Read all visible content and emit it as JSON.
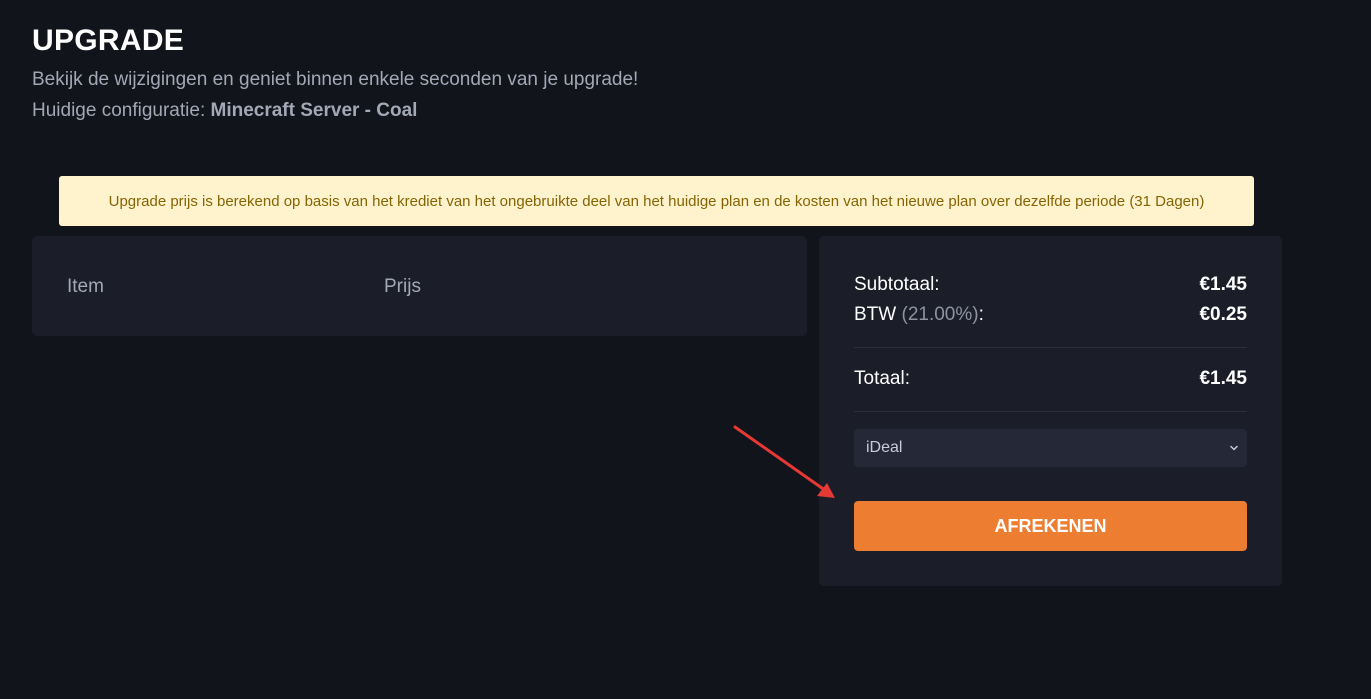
{
  "header": {
    "title": "UPGRADE",
    "subtitle": "Bekijk de wijzigingen en geniet binnen enkele seconden van je upgrade!",
    "config_label": "Huidige configuratie: ",
    "config_value": "Minecraft Server - Coal"
  },
  "notice": {
    "text": "Upgrade prijs is berekend op basis van het krediet van het ongebruikte deel van het huidige plan en de kosten van het nieuwe plan over dezelfde periode (31 Dagen)"
  },
  "items_table": {
    "columns": [
      "Item",
      "Prijs"
    ]
  },
  "summary": {
    "subtotal_label": "Subtotaal:",
    "subtotal_value": "€1.45",
    "tax_label": "BTW",
    "tax_percent": "(21.00%)",
    "tax_colon": ":",
    "tax_value": "€0.25",
    "total_label": "Totaal:",
    "total_value": "€1.45",
    "payment_method": "iDeal",
    "checkout_label": "AFREKENEN"
  },
  "colors": {
    "background": "#12141c",
    "card": "#1b1d29",
    "accent": "#ed7d31",
    "notice_bg": "#fff3cd",
    "notice_text": "#856404",
    "annotation_arrow": "#e53935"
  },
  "icons": {
    "select_caret": "chevron-down-icon",
    "annotation": "red-arrow-icon"
  }
}
